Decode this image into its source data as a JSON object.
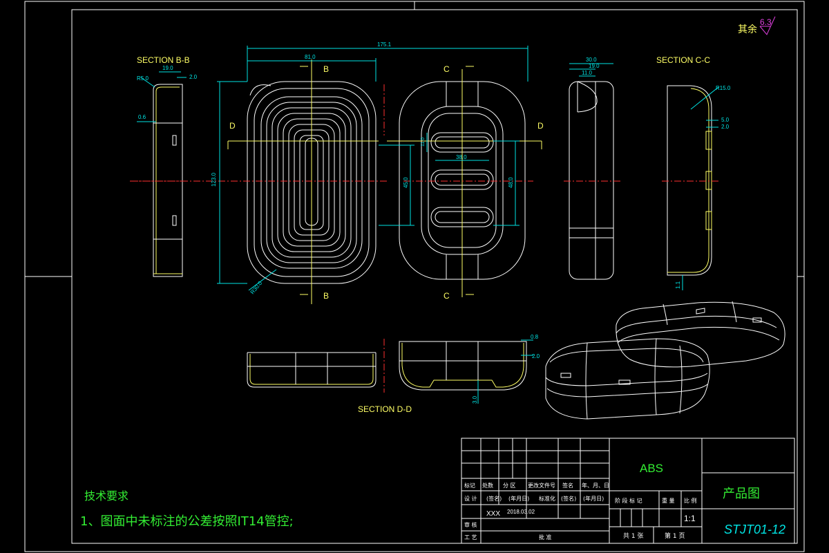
{
  "drawing": {
    "surface_roughness": {
      "label": "其余",
      "value": "6.3"
    },
    "sections": {
      "bb": "SECTION B-B",
      "cc": "SECTION C-C",
      "dd": "SECTION D-D"
    },
    "cut_marks": {
      "b": "B",
      "c": "C",
      "d": "D"
    },
    "dimensions": {
      "overall_width": "175.1",
      "left_width": "81.0",
      "height": "123.0",
      "slot_w": "38.0",
      "slot_pitch_left": "45.0",
      "slot_pitch_right": "48.0",
      "slot_h": "11.0",
      "radius_big": "R30.0",
      "bb_w": "19.0",
      "bb_t": "2.0",
      "bb_r": "R5.0",
      "bb_wall": "0.6",
      "side_w": "30.0",
      "side_a": "19.0",
      "side_b": "11.0",
      "cc_r": "R15.0",
      "cc_a": "5.0",
      "cc_b": "2.0",
      "cc_c": "1.1",
      "dd_a": "0.8",
      "dd_b": "2.0",
      "dd_c": "3.0"
    }
  },
  "tech_req": {
    "title": "技术要求",
    "item1": "1、图面中未标注的公差按照IT14管控;"
  },
  "title_block": {
    "material": "ABS",
    "drawing_name": "产品图",
    "drawing_no": "STJT01-12",
    "scale": "1:1",
    "designer": "XXX",
    "date": "2018.03.02",
    "h_mark": "标记",
    "h_count": "处数",
    "h_zone": "分 区",
    "h_docno": "更改文件号",
    "h_sign": "签名",
    "h_ymd": "年、月、日",
    "h_design": "设 计",
    "h_sign2": "(签名)",
    "h_ymd2": "(年月日)",
    "h_std": "标准化",
    "h_sign3": "(签名)",
    "h_ymd3": "(年月日)",
    "h_review": "审 核",
    "h_process": "工 艺",
    "h_approve": "批 准",
    "h_stage": "阶 段 标 记",
    "h_weight": "重 量",
    "h_ratio": "比 例",
    "sheets_total": "共 1 张",
    "sheet_no": "第 1 页"
  }
}
